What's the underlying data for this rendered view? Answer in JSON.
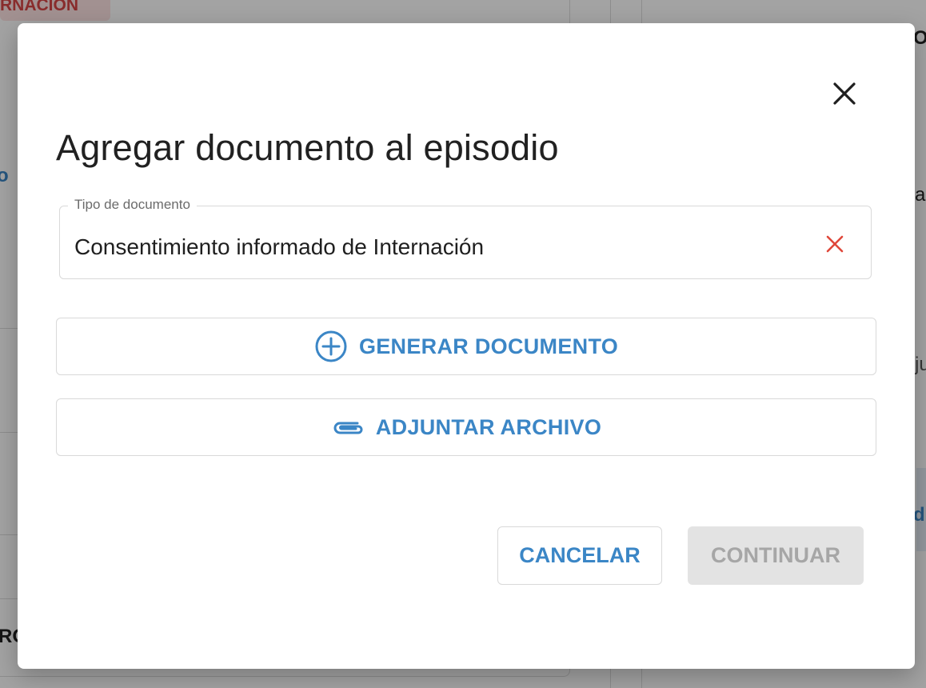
{
  "background": {
    "badge_text": "RNACION",
    "fragment_1": "o",
    "fragment_2": "a",
    "fragment_3": "ju",
    "fragment_4": "d",
    "fragment_5": "RO",
    "fragment_6": "O"
  },
  "dialog": {
    "title": "Agregar documento al episodio",
    "close_icon": "close-icon",
    "field": {
      "label": "Tipo de documento",
      "value": "Consentimiento informado de Internación",
      "clear_icon": "clear-icon"
    },
    "generate_button": {
      "label": "GENERAR DOCUMENTO",
      "icon": "plus-circle-icon"
    },
    "attach_button": {
      "label": "ADJUNTAR ARCHIVO",
      "icon": "paperclip-icon"
    },
    "cancel_label": "CANCELAR",
    "continue_label": "CONTINUAR",
    "continue_disabled": true
  },
  "colors": {
    "accent": "#3b86c6",
    "danger": "#e0473a",
    "disabled_bg": "#e3e3e3",
    "disabled_text": "#a6a6a6",
    "title_text": "#212121"
  }
}
